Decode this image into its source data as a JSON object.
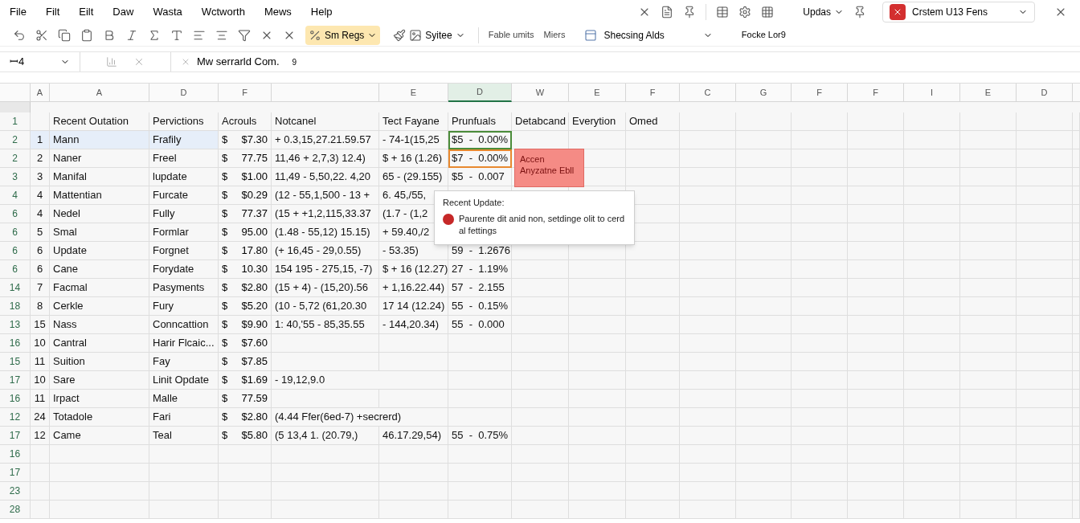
{
  "menu": [
    "File",
    "Filt",
    "Eilt",
    "Daw",
    "Wasta",
    "Wctworth",
    "Mews",
    "Help"
  ],
  "toolbar": {
    "left_dropdowns": [
      {
        "label": "Sm Regs",
        "selected": true
      },
      {
        "label": "Syitee",
        "selected": false
      }
    ],
    "ribbon_labels": [
      "Fable umits",
      "Miers"
    ],
    "update_button": "Updas",
    "checking_button": "Shecsing Alds",
    "account": {
      "label": "Crstem U13 Fens",
      "sub": "Focke Lor9"
    }
  },
  "formula_bar": {
    "cell": "ꟷ4",
    "formula": "Mw serrarld Com.",
    "extra": "9"
  },
  "columns": [
    {
      "label": "A",
      "selected": false
    },
    {
      "label": "A",
      "selected": false
    },
    {
      "label": "D",
      "selected": false
    },
    {
      "label": "F",
      "selected": false
    },
    {
      "selected": false
    },
    {
      "label": "E",
      "selected": false
    },
    {
      "label": "D",
      "selected": true
    },
    {
      "label": "W",
      "selected": false
    },
    {
      "label": "E",
      "selected": false
    },
    {
      "label": "F",
      "selected": false
    },
    {
      "label": "C",
      "selected": false
    },
    {
      "label": "G",
      "selected": false
    },
    {
      "label": "F",
      "selected": false
    },
    {
      "label": "F",
      "selected": false
    },
    {
      "label": "I",
      "selected": false
    },
    {
      "label": "E",
      "selected": false
    },
    {
      "label": "D",
      "selected": false
    }
  ],
  "header_row": {
    "num": "1",
    "cells": [
      "",
      "Recent Outation",
      "Pervictions",
      "Acrouls",
      "Notcanel",
      "Tect Fayane",
      "Prunfuals",
      "Detabcand",
      "Everytion",
      "Omed"
    ]
  },
  "rows": [
    {
      "num": "2",
      "idx": "1",
      "name": "Mann",
      "kind_label": "Frafily",
      "cur": "$",
      "amount": "$7.30",
      "notcanel": "+ 0.3,15,27.21.59.57",
      "tect": "- 74-1(15,25",
      "prunfuals": "$5  -  0.00%",
      "highlighted": true,
      "selected": true,
      "flagged": false
    },
    {
      "num": "2",
      "idx": "2",
      "name": "Naner",
      "kind_label": "Freel",
      "cur": "$",
      "amount": "77.75",
      "notcanel": "11,46 + 2,7,3) 12.4)",
      "tect": "$ + 16 (1.26)",
      "prunfuals": "$7  -  0.00%",
      "highlighted": false,
      "selected": false,
      "flagged": true
    },
    {
      "num": "3",
      "idx": "3",
      "name": "Manifal",
      "kind_label": "lupdate",
      "cur": "$",
      "amount": "$1.00",
      "notcanel": "11,49 - 5,50,22. 4,20",
      "tect": "65 - (29.155)",
      "prunfuals": "$5  -  0.007",
      "highlighted": false,
      "selected": false,
      "flagged": false
    },
    {
      "num": "4",
      "idx": "4",
      "name": "Mattentian",
      "kind_label": "Furcate",
      "cur": "$",
      "amount": "$0.29",
      "notcanel": "(12 - 55,1,500 - 13 +",
      "tect": "6. 45,/55,",
      "prunfuals": "",
      "highlighted": false,
      "selected": false,
      "flagged": false
    },
    {
      "num": "6",
      "idx": "4",
      "name": "Nedel",
      "kind_label": "Fully",
      "cur": "$",
      "amount": "77.37",
      "notcanel": "(15 + +1,2,115,33.37",
      "tect": "(1.7 - (1,2",
      "prunfuals": "",
      "highlighted": false
    },
    {
      "num": "6",
      "idx": "5",
      "name": "Smal",
      "kind_label": "Formlar",
      "cur": "$",
      "amount": "95.00",
      "notcanel": "(1.48 - 55,12) 15.15)",
      "tect": "+ 59.40,/2",
      "prunfuals": "",
      "highlighted": false
    },
    {
      "num": "6",
      "idx": "6",
      "name": "Update",
      "kind_label": "Forgnet",
      "cur": "$",
      "amount": "17.80",
      "notcanel": "(+ 16,45 - 29,0.55)",
      "tect": "- 53.35)",
      "prunfuals": "59  -  1.2676",
      "highlighted": false,
      "selected": false,
      "flagged": false
    },
    {
      "num": "6",
      "idx": "6",
      "name": "Cane",
      "kind_label": "Forydate",
      "cur": "$",
      "amount": "10.30",
      "notcanel": "154 195 - 275,15, -7)",
      "tect": "$ + 16 (12.27)",
      "prunfuals": "27  -  1.19%",
      "highlighted": false,
      "selected": false,
      "flagged": false
    },
    {
      "num": "14",
      "idx": "7",
      "name": "Facmal",
      "kind_label": "Pasyments",
      "cur": "$",
      "amount": "$2.80",
      "notcanel": "(15 + 4) - (15,20).56",
      "tect": "+ 1,16.22.44)",
      "prunfuals": "57  -  2.155",
      "highlighted": false,
      "selected": false,
      "flagged": false
    },
    {
      "num": "18",
      "idx": "8",
      "name": "Cerkle",
      "kind_label": "Fury",
      "cur": "$",
      "amount": "$5.20",
      "notcanel": "(10 - 5,72 (61,20.30",
      "tect": "17 14 (12.24)",
      "prunfuals": "55  -  0.15%",
      "highlighted": false,
      "selected": false,
      "flagged": false
    },
    {
      "num": "13",
      "idx": "15",
      "name": "Nass",
      "kind_label": "Conncattion",
      "cur": "$",
      "amount": "$9.90",
      "notcanel": "1: 40,'55 - 85,35.55",
      "tect": "- 144,20.34)",
      "prunfuals": "55  -  0.000",
      "highlighted": false,
      "selected": false,
      "flagged": false
    },
    {
      "num": "16",
      "idx": "10",
      "name": "Cantral",
      "kind_label": "Harir Flcaic...",
      "cur": "$",
      "amount": "$7.60",
      "notcanel": "",
      "tect": "",
      "prunfuals": "",
      "highlighted": false,
      "selected": false,
      "flagged": false
    },
    {
      "num": "15",
      "idx": "11",
      "name": "Suition",
      "kind_label": "Fay",
      "cur": "$",
      "amount": "$7.85",
      "notcanel": "",
      "tect": "",
      "prunfuals": "",
      "highlighted": false,
      "selected": false,
      "flagged": false
    },
    {
      "num": "17",
      "idx": "10",
      "name": "Sare",
      "kind_label": "Linit Opdate",
      "cur": "$",
      "amount": "$1.69",
      "notcanel": "- 19,12,9.0",
      "tect": "",
      "prunfuals": "",
      "highlighted": false,
      "selected": false,
      "flagged": false
    },
    {
      "num": "16",
      "idx": "11",
      "name": "Irpact",
      "kind_label": "Malle",
      "cur": "$",
      "amount": "77.59",
      "notcanel": "",
      "tect": "",
      "prunfuals": "",
      "highlighted": false,
      "selected": false,
      "flagged": false
    },
    {
      "num": "12",
      "idx": "24",
      "name": "Totadole",
      "kind_label": "Fari",
      "cur": "$",
      "amount": "$2.80",
      "notcanel": "(4.44 Ffer(6ed-7) +secrerd)",
      "tect": "",
      "prunfuals": "",
      "highlighted": false,
      "selected": false,
      "flagged": false
    },
    {
      "num": "17",
      "idx": "12",
      "name": "Came",
      "kind_label": "Teal",
      "cur": "$",
      "amount": "$5.80",
      "notcanel": "(5 13,4 1. (20.79,)",
      "tect": "46.17.29,54)",
      "prunfuals": "55  -  0.75%",
      "highlighted": false,
      "selected": false,
      "flagged": false
    }
  ],
  "empty_rows": [
    "16",
    "17",
    "23",
    "28"
  ],
  "comment": {
    "text": "Accen Anyzatne Ebll"
  },
  "tooltip": {
    "title": "Recent Update:",
    "message": "Paurente dit anid non, setdinge olit to cerd al fettings"
  }
}
